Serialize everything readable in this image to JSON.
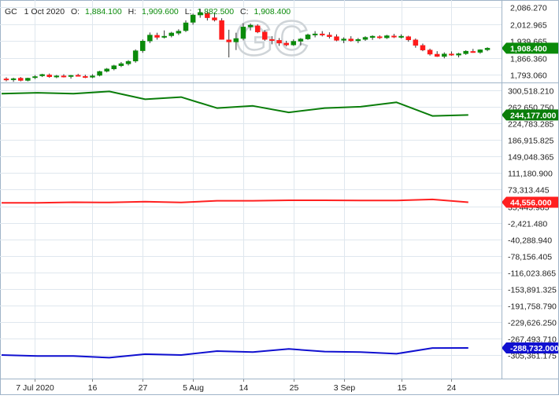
{
  "header": {
    "symbol": "GC",
    "date": "1 Oct 2020",
    "open_label": "O:",
    "open": "1,884.100",
    "high_label": "H:",
    "high": "1,909.600",
    "low_label": "L:",
    "low": "1,882.500",
    "close_label": "C:",
    "close": "1,908.400"
  },
  "watermark": "GC",
  "colors": {
    "up": "#0a8a0a",
    "down": "#ff1a1a",
    "grid": "#dfe7ee",
    "border": "#9fb4c8",
    "cot_commercial": "#0a7d0a",
    "cot_noncommercial": "#ff2020",
    "cot_small": "#1010d0"
  },
  "chart_data": [
    {
      "type": "candlestick",
      "title": "GC",
      "x_tick_labels": [
        "7 Jul 2020",
        "16",
        "27",
        "5 Aug",
        "14",
        "25",
        "3 Sep",
        "15",
        "24"
      ],
      "y_tick_labels": [
        "2,086.270",
        "2,012.965",
        "1,939.665",
        "1,866.360",
        "1,793.060"
      ],
      "ylim": [
        1756,
        2100
      ],
      "last_value_label": "1,908.400",
      "candles": [
        {
          "o": 1775,
          "h": 1782,
          "l": 1764,
          "c": 1770
        },
        {
          "o": 1771,
          "h": 1780,
          "l": 1762,
          "c": 1776
        },
        {
          "o": 1778,
          "h": 1783,
          "l": 1764,
          "c": 1768
        },
        {
          "o": 1768,
          "h": 1780,
          "l": 1764,
          "c": 1778
        },
        {
          "o": 1780,
          "h": 1791,
          "l": 1774,
          "c": 1785
        },
        {
          "o": 1788,
          "h": 1797,
          "l": 1783,
          "c": 1794
        },
        {
          "o": 1792,
          "h": 1798,
          "l": 1780,
          "c": 1784
        },
        {
          "o": 1785,
          "h": 1792,
          "l": 1778,
          "c": 1788
        },
        {
          "o": 1788,
          "h": 1795,
          "l": 1781,
          "c": 1785
        },
        {
          "o": 1786,
          "h": 1792,
          "l": 1776,
          "c": 1790
        },
        {
          "o": 1791,
          "h": 1797,
          "l": 1785,
          "c": 1787
        },
        {
          "o": 1786,
          "h": 1793,
          "l": 1778,
          "c": 1782
        },
        {
          "o": 1782,
          "h": 1795,
          "l": 1778,
          "c": 1788
        },
        {
          "o": 1790,
          "h": 1810,
          "l": 1786,
          "c": 1807
        },
        {
          "o": 1808,
          "h": 1822,
          "l": 1803,
          "c": 1818
        },
        {
          "o": 1818,
          "h": 1836,
          "l": 1812,
          "c": 1832
        },
        {
          "o": 1832,
          "h": 1848,
          "l": 1826,
          "c": 1841
        },
        {
          "o": 1840,
          "h": 1856,
          "l": 1833,
          "c": 1851
        },
        {
          "o": 1852,
          "h": 1903,
          "l": 1845,
          "c": 1897
        },
        {
          "o": 1897,
          "h": 1946,
          "l": 1888,
          "c": 1939
        },
        {
          "o": 1939,
          "h": 1976,
          "l": 1930,
          "c": 1965
        },
        {
          "o": 1964,
          "h": 1975,
          "l": 1945,
          "c": 1955
        },
        {
          "o": 1955,
          "h": 1985,
          "l": 1950,
          "c": 1960
        },
        {
          "o": 1962,
          "h": 1979,
          "l": 1955,
          "c": 1974
        },
        {
          "o": 1973,
          "h": 1990,
          "l": 1965,
          "c": 1982
        },
        {
          "o": 1984,
          "h": 2029,
          "l": 1978,
          "c": 2018
        },
        {
          "o": 2020,
          "h": 2058,
          "l": 2010,
          "c": 2052
        },
        {
          "o": 2052,
          "h": 2079,
          "l": 2040,
          "c": 2063
        },
        {
          "o": 2060,
          "h": 2068,
          "l": 2028,
          "c": 2040
        },
        {
          "o": 2040,
          "h": 2063,
          "l": 2024,
          "c": 2030
        },
        {
          "o": 2028,
          "h": 2038,
          "l": 1945,
          "c": 1946
        },
        {
          "o": 1944,
          "h": 1988,
          "l": 1868,
          "c": 1935
        },
        {
          "o": 1935,
          "h": 1975,
          "l": 1900,
          "c": 1950
        },
        {
          "o": 1950,
          "h": 2016,
          "l": 1942,
          "c": 2000
        },
        {
          "o": 2000,
          "h": 2015,
          "l": 1985,
          "c": 2008
        },
        {
          "o": 2005,
          "h": 2012,
          "l": 1973,
          "c": 1978
        },
        {
          "o": 1978,
          "h": 1986,
          "l": 1940,
          "c": 1946
        },
        {
          "o": 1946,
          "h": 1960,
          "l": 1925,
          "c": 1942
        },
        {
          "o": 1942,
          "h": 1952,
          "l": 1918,
          "c": 1930
        },
        {
          "o": 1930,
          "h": 1940,
          "l": 1916,
          "c": 1922
        },
        {
          "o": 1922,
          "h": 1946,
          "l": 1918,
          "c": 1938
        },
        {
          "o": 1938,
          "h": 1952,
          "l": 1920,
          "c": 1948
        },
        {
          "o": 1948,
          "h": 1971,
          "l": 1944,
          "c": 1966
        },
        {
          "o": 1965,
          "h": 1982,
          "l": 1955,
          "c": 1970
        },
        {
          "o": 1970,
          "h": 1982,
          "l": 1959,
          "c": 1966
        },
        {
          "o": 1965,
          "h": 1977,
          "l": 1950,
          "c": 1958
        },
        {
          "o": 1958,
          "h": 1968,
          "l": 1938,
          "c": 1942
        },
        {
          "o": 1942,
          "h": 1955,
          "l": 1930,
          "c": 1948
        },
        {
          "o": 1948,
          "h": 1960,
          "l": 1936,
          "c": 1940
        },
        {
          "o": 1940,
          "h": 1952,
          "l": 1930,
          "c": 1946
        },
        {
          "o": 1946,
          "h": 1960,
          "l": 1940,
          "c": 1955
        },
        {
          "o": 1954,
          "h": 1964,
          "l": 1944,
          "c": 1960
        },
        {
          "o": 1958,
          "h": 1964,
          "l": 1948,
          "c": 1953
        },
        {
          "o": 1953,
          "h": 1966,
          "l": 1948,
          "c": 1962
        },
        {
          "o": 1961,
          "h": 1970,
          "l": 1952,
          "c": 1958
        },
        {
          "o": 1957,
          "h": 1968,
          "l": 1950,
          "c": 1960
        },
        {
          "o": 1958,
          "h": 1962,
          "l": 1936,
          "c": 1944
        },
        {
          "o": 1944,
          "h": 1950,
          "l": 1910,
          "c": 1920
        },
        {
          "o": 1920,
          "h": 1928,
          "l": 1895,
          "c": 1900
        },
        {
          "o": 1900,
          "h": 1906,
          "l": 1876,
          "c": 1882
        },
        {
          "o": 1882,
          "h": 1895,
          "l": 1870,
          "c": 1872
        },
        {
          "o": 1872,
          "h": 1890,
          "l": 1864,
          "c": 1883
        },
        {
          "o": 1883,
          "h": 1894,
          "l": 1875,
          "c": 1878
        },
        {
          "o": 1878,
          "h": 1888,
          "l": 1868,
          "c": 1884
        },
        {
          "o": 1884,
          "h": 1899,
          "l": 1879,
          "c": 1895
        },
        {
          "o": 1894,
          "h": 1905,
          "l": 1888,
          "c": 1891
        },
        {
          "o": 1890,
          "h": 1903,
          "l": 1884,
          "c": 1901
        },
        {
          "o": 1901,
          "h": 1912,
          "l": 1895,
          "c": 1908
        }
      ]
    },
    {
      "type": "line",
      "title": "",
      "y_tick_labels": [
        "300,518.210",
        "262,650.750",
        "224,783.285",
        "186,915.825",
        "149,048.365",
        "111,180.900",
        "73,313.445",
        "35,445.985",
        "-2,421.480",
        "-40,288.940",
        "-78,156.405",
        "-116,023.865",
        "-153,891.325",
        "-191,758.790",
        "-229,626.250",
        "-267,493.710",
        "-305,361.175"
      ],
      "ylim": [
        -320000,
        315000
      ],
      "x_index": [
        0,
        5,
        10,
        15,
        20,
        25,
        30,
        35,
        40,
        45,
        50,
        55,
        60,
        65
      ],
      "series": [
        {
          "name": "",
          "color": "#0a7d0a",
          "last_value_label": "244,177.000",
          "values": [
            293000,
            295000,
            293000,
            298000,
            280000,
            285000,
            260000,
            265000,
            250000,
            260000,
            263000,
            273000,
            242000,
            244177
          ]
        },
        {
          "name": "",
          "color": "#ff2020",
          "last_value_label": "44,556.000",
          "values": [
            43000,
            43000,
            44500,
            44000,
            46000,
            44000,
            48000,
            48000,
            49000,
            49000,
            48500,
            48500,
            51000,
            44556
          ]
        },
        {
          "name": "",
          "color": "#1010d0",
          "last_value_label": "-288,732.000",
          "values": [
            -305000,
            -307000,
            -307000,
            -311000,
            -303000,
            -305000,
            -296000,
            -298000,
            -291000,
            -297000,
            -298000,
            -302000,
            -289000,
            -288732
          ]
        }
      ]
    }
  ]
}
